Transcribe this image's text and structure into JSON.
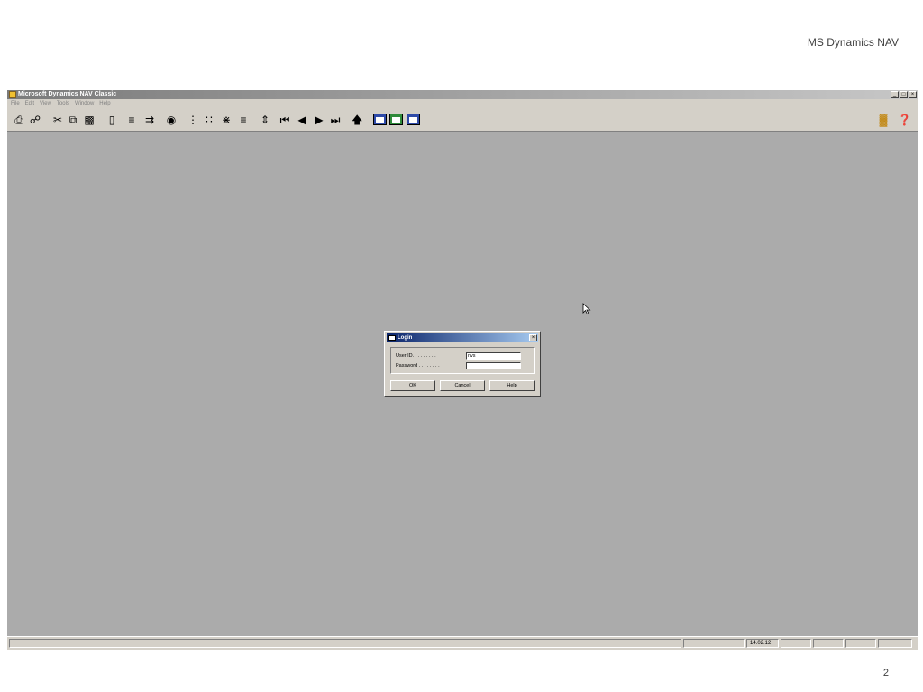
{
  "slide": {
    "title": "MS Dynamics NAV",
    "page_number": "2"
  },
  "app": {
    "window_title": "Microsoft Dynamics NAV Classic",
    "window_buttons": [
      "_",
      "×"
    ],
    "menu": [
      "File",
      "Edit",
      "View",
      "Tools",
      "Window",
      "Help"
    ],
    "toolbar_icons": [
      "print-icon",
      "print-preview-icon",
      "cut-icon",
      "copy-icon",
      "paste-icon",
      "attachment-icon",
      "insert-icon",
      "next-field-icon",
      "find-icon",
      "filter-icon",
      "field-filter-icon",
      "flowfilter-icon",
      "show-all-icon",
      "sort-icon",
      "first-icon",
      "previous-icon",
      "next-icon",
      "last-icon",
      "up-icon",
      "form-icon",
      "table-icon",
      "report-icon",
      "analysis-icon",
      "help-icon"
    ],
    "status_bar": {
      "date": "14.02.12"
    }
  },
  "login": {
    "title": "Login",
    "close": "×",
    "user_id_label": "User ID. . . . . . . . .",
    "user_id_value": "nvs",
    "password_label": "Password . . . . . . . .",
    "password_value": "",
    "ok": "OK",
    "cancel": "Cancel",
    "help": "Help"
  }
}
